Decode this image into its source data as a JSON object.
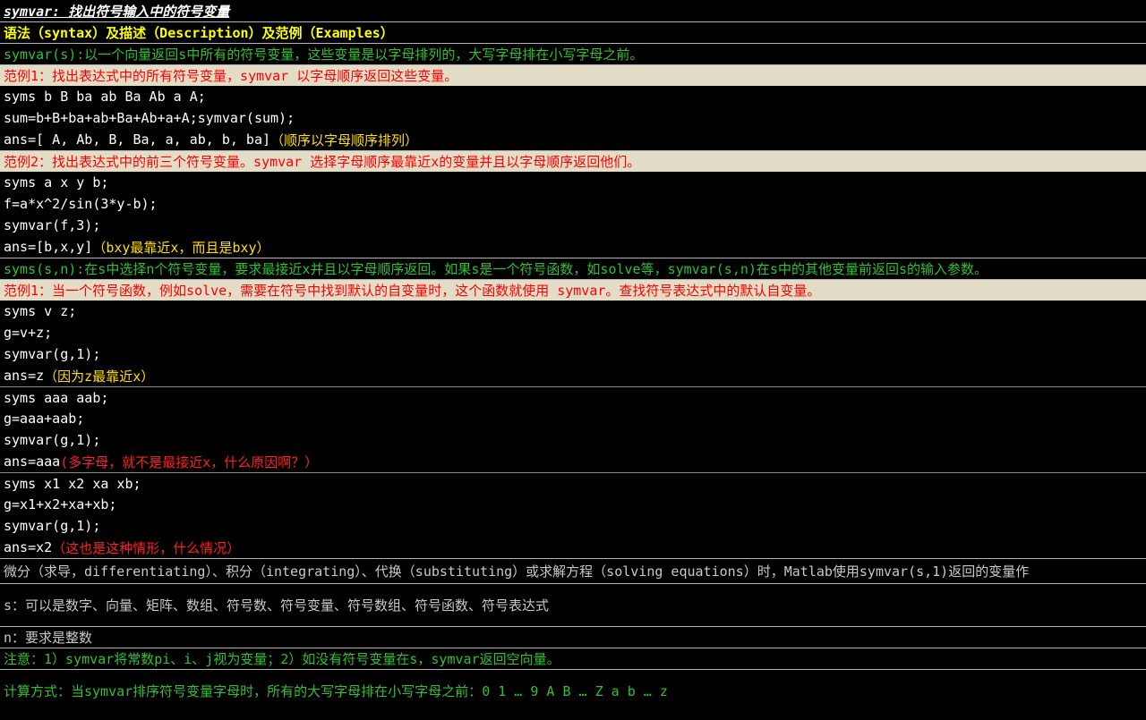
{
  "title": "symvar: 找出符号输入中的符号变量",
  "section_header": "语法（syntax）及描述（Description）及范例（Examples）",
  "desc1": "symvar(s):以一个向量返回s中所有的符号变量，这些变量是以字母排列的，大写字母排在小写字母之前。",
  "ex1": {
    "heading": "范例1：找出表达式中的所有符号变量，symvar 以字母顺序返回这些变量。",
    "lines": [
      "syms b B ba ab Ba Ab a A;",
      "sum=b+B+ba+ab+Ba+Ab+a+A;symvar(sum);"
    ],
    "ans_code": "ans=[ A, Ab, B, Ba, a, ab, b, ba]",
    "ans_note": "（顺序以字母顺序排列）"
  },
  "ex2": {
    "heading": "范例2：找出表达式中的前三个符号变量。symvar 选择字母顺序最靠近x的变量并且以字母顺序返回他们。",
    "lines": [
      "syms a x y b;",
      "f=a*x^2/sin(3*y-b);",
      "symvar(f,3);"
    ],
    "ans_code": "ans=[b,x,y]",
    "ans_note": "（bxy最靠近x，而且是bxy）"
  },
  "desc2": "syms(s,n):在s中选择n个符号变量，要求最接近x并且以字母顺序返回。如果s是一个符号函数，如solve等，symvar(s,n)在s中的其他变量前返回s的输入参数。",
  "ex3": {
    "heading": "范例1：当一个符号函数，例如solve，需要在符号中找到默认的自变量时，这个函数就使用 symvar。查找符号表达式中的默认自变量。",
    "lines": [
      "syms v z;",
      "g=v+z;",
      "symvar(g,1);"
    ],
    "ans_code": "ans=z",
    "ans_note": "（因为z最靠近x）"
  },
  "ex4": {
    "lines": [
      "syms aaa aab;",
      "g=aaa+aab;",
      "symvar(g,1);"
    ],
    "ans_code": "ans=aaa",
    "ans_note": "(多字母，就不是最接近x，什么原因啊？）"
  },
  "ex5": {
    "lines": [
      "syms x1 x2 xa xb;",
      "g=x1+x2+xa+xb;",
      "symvar(g,1);"
    ],
    "ans_code": "ans=x2",
    "ans_note": "（这也是这种情形，什么情况）"
  },
  "note_diff": "微分（求导，differentiating）、积分（integrating）、代换（substituting）或求解方程（solving equations）时，Matlab使用symvar(s,1)返回的变量作",
  "note_s": "s：可以是数字、向量、矩阵、数组、符号数、符号变量、符号数组、符号函数、符号表达式",
  "note_n": "n：要求是整数",
  "note_attention": "注意：1）symvar将常数pi、i、j视为变量；2）如没有符号变量在s，symvar返回空向量。",
  "note_calc": "计算方式：当symvar排序符号变量字母时，所有的大写字母排在小写字母之前：0 1 … 9 A B … Z a b … z"
}
